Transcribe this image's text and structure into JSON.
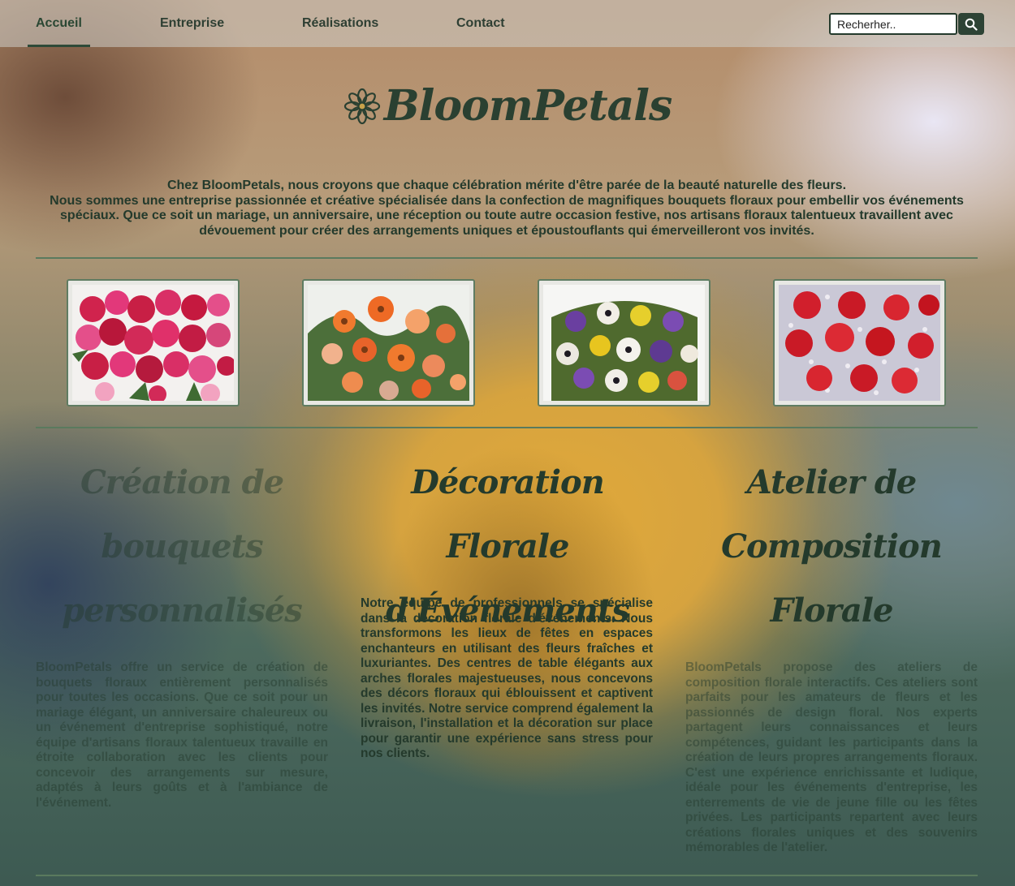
{
  "nav": {
    "items": [
      {
        "label": "Accueil"
      },
      {
        "label": "Entreprise"
      },
      {
        "label": "Réalisations"
      },
      {
        "label": "Contact"
      }
    ],
    "search": {
      "placeholder": "Recherher..",
      "icon": "search-icon"
    }
  },
  "brand": {
    "name": "BloomPetals",
    "icon": "flower-icon"
  },
  "intro": {
    "line1": "Chez BloomPetals, nous croyons que chaque célébration mérite d'être parée de la beauté naturelle des fleurs.",
    "line2": "Nous sommes une entreprise passionnée et créative spécialisée dans la confection de magnifiques bouquets floraux pour embellir vos événements spéciaux. Que ce soit un mariage, un anniversaire, une réception ou toute autre occasion festive, nos artisans floraux talentueux travaillent avec dévouement pour créer des arrangements uniques et époustouflants qui émerveilleront vos invités."
  },
  "gallery": [
    {
      "name": "bouquet-roses-pink-red"
    },
    {
      "name": "bouquet-orange-gerbera"
    },
    {
      "name": "bouquet-mixed-anemone"
    },
    {
      "name": "bouquet-red-roses-gypsophila"
    }
  ],
  "services": [
    {
      "title": "Création de bouquets personnalisés",
      "text": "BloomPetals offre un service de création de bouquets floraux entièrement personnalisés pour toutes les occasions. Que ce soit pour un mariage élégant, un anniversaire chaleureux ou un événement d'entreprise sophistiqué, notre équipe d'artisans floraux talentueux travaille en étroite collaboration avec les clients pour concevoir des arrangements sur mesure, adaptés à leurs goûts et à l'ambiance de l'événement."
    },
    {
      "title": "Décoration Florale d'Événements",
      "text": "Notre équipe de professionnels se spécialise dans la décoration florale d'événements. Nous transformons les lieux de fêtes en espaces enchanteurs en utilisant des fleurs fraîches et luxuriantes. Des centres de table élégants aux arches florales majestueuses, nous concevons des décors floraux qui éblouissent et captivent les invités. Notre service comprend également la livraison, l'installation et la décoration sur place pour garantir une expérience sans stress pour nos clients."
    },
    {
      "title": "Atelier de Composition Florale",
      "text": "BloomPetals propose des ateliers de composition florale interactifs. Ces ateliers sont parfaits pour les amateurs de fleurs et les passionnés de design floral. Nos experts partagent leurs connaissances et leurs compétences, guidant les participants dans la création de leurs propres arrangements floraux. C'est une expérience enrichissante et ludique, idéale pour les événements d'entreprise, les enterrements de vie de jeune fille ou les fêtes privées. Les participants repartent avec leurs créations florales uniques et des souvenirs mémorables de l'atelier."
    }
  ]
}
